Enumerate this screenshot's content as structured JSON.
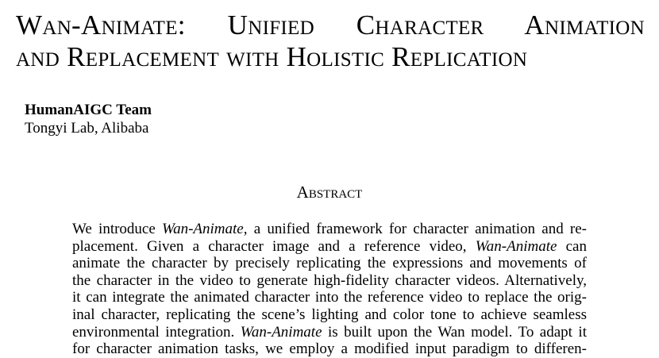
{
  "title": {
    "line1": "Wan-Animate:  Unified Character Animation",
    "line2": "and Replacement with Holistic Replication"
  },
  "author": "HumanAIGC Team",
  "affiliation": "Tongyi Lab, Alibaba",
  "abstract_heading": "Abstract",
  "abstract_lines": [
    [
      {
        "t": "We introduce "
      },
      {
        "t": "Wan-Animate",
        "i": true
      },
      {
        "t": ", a unified framework for character animation and re-"
      }
    ],
    [
      {
        "t": "placement.  Given a character image and a reference video, "
      },
      {
        "t": "Wan-Animate",
        "i": true
      },
      {
        "t": " can"
      }
    ],
    [
      {
        "t": "animate the character by precisely replicating the expressions and movements of"
      }
    ],
    [
      {
        "t": "the character in the video to generate high-fidelity character videos. Alternatively,"
      }
    ],
    [
      {
        "t": "it can integrate the animated character into the reference video to replace the orig-"
      }
    ],
    [
      {
        "t": "inal character, replicating the scene’s lighting and color tone to achieve seamless"
      }
    ],
    [
      {
        "t": "environmental integration. "
      },
      {
        "t": "Wan-Animate",
        "i": true
      },
      {
        "t": " is built upon the Wan model. To adapt it"
      }
    ],
    [
      {
        "t": "for character animation tasks, we employ a modified input paradigm to differen-"
      }
    ]
  ]
}
